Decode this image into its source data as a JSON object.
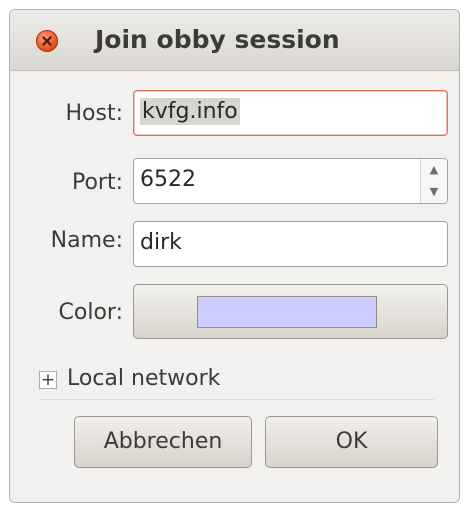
{
  "dialog": {
    "title": "Join obby session"
  },
  "form": {
    "host": {
      "label": "Host:",
      "value": "kvfg.info"
    },
    "port": {
      "label": "Port:",
      "value": "6522"
    },
    "name": {
      "label": "Name:",
      "value": "dirk"
    },
    "color": {
      "label": "Color:",
      "swatch_color": "#ccccff"
    }
  },
  "expander": {
    "symbol": "+",
    "label": "Local network"
  },
  "buttons": {
    "cancel_label": "Abbrechen",
    "ok_label": "OK"
  },
  "icons": {
    "close": "close-icon",
    "spin_up": "chevron-up-icon",
    "spin_down": "chevron-down-icon"
  }
}
